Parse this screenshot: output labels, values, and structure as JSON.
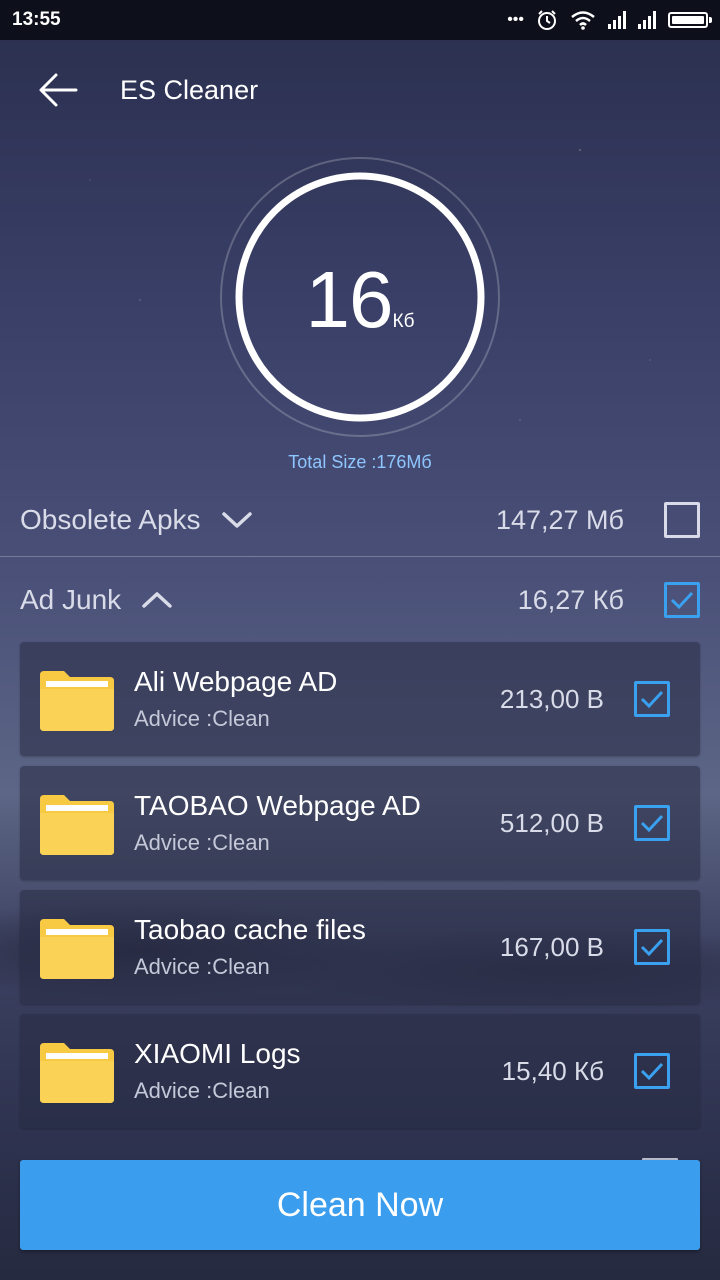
{
  "status_bar": {
    "time": "13:55",
    "more": "•••"
  },
  "app_bar": {
    "title": "ES Cleaner"
  },
  "gauge": {
    "value": "16",
    "unit": "Кб",
    "total_label": "Total Size :176Мб"
  },
  "categories": [
    {
      "name": "Obsolete Apks",
      "size": "147,27 Мб",
      "checked": false,
      "expanded": false
    },
    {
      "name": "Ad Junk",
      "size": "16,27 Кб",
      "checked": true,
      "expanded": true
    }
  ],
  "items": [
    {
      "title": "Ali Webpage AD",
      "advice": "Advice :Clean",
      "size": "213,00 B",
      "checked": true
    },
    {
      "title": "TAOBAO Webpage AD",
      "advice": "Advice :Clean",
      "size": "512,00 B",
      "checked": true
    },
    {
      "title": "Taobao cache files",
      "advice": "Advice :Clean",
      "size": "167,00 B",
      "checked": true
    },
    {
      "title": "XIAOMI Logs",
      "advice": "Advice :Clean",
      "size": "15,40 Кб",
      "checked": true
    }
  ],
  "actions": {
    "clean_now": "Clean Now"
  },
  "colors": {
    "accent": "#3a9ded",
    "checkbox_checked": "#3aa0f0",
    "folder": "#f8c943",
    "total_text": "#8fc6ff"
  }
}
